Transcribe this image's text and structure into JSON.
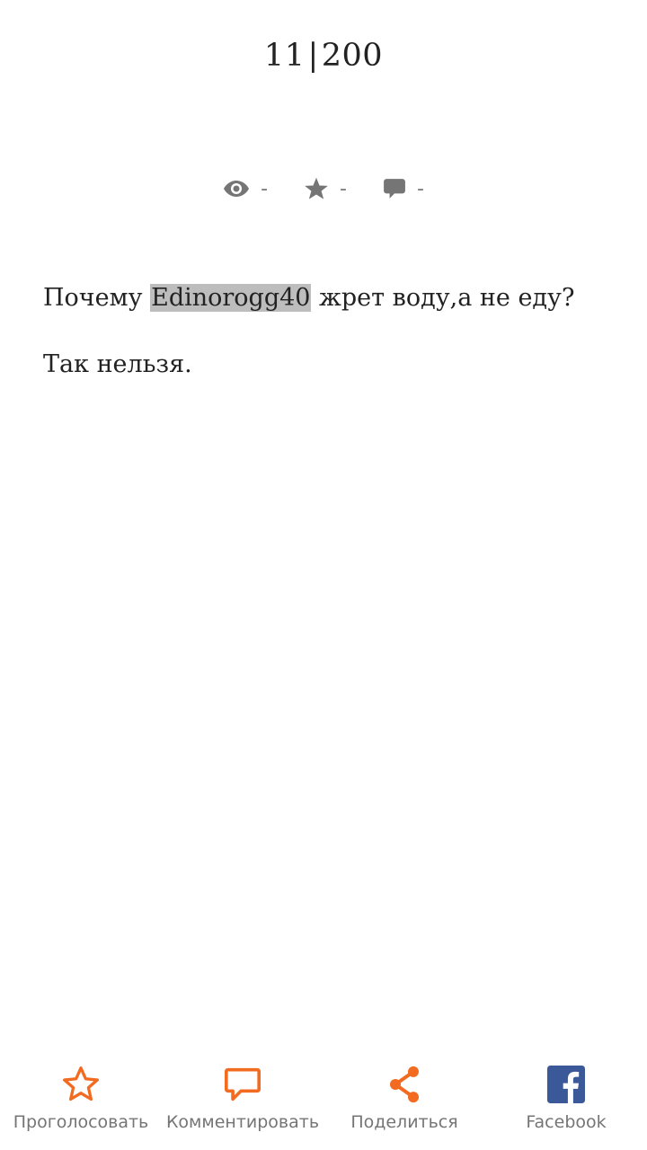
{
  "header": {
    "current_page": "11",
    "separator": "|",
    "total_pages": "200"
  },
  "stats": {
    "views": "-",
    "votes": "-",
    "comments": "-"
  },
  "story": {
    "line1_before": "Почему ",
    "line1_highlight": "Edinorogg40",
    "line1_after": " жрет воду,а не еду?",
    "line2": "Так нельзя."
  },
  "actions": {
    "vote": "Проголосовать",
    "comment": "Комментировать",
    "share": "Поделиться",
    "facebook": "Facebook"
  },
  "colors": {
    "accent": "#f26b21",
    "icon_gray": "#757575",
    "facebook_blue": "#3b5998",
    "highlight": "#bdbdbd"
  }
}
